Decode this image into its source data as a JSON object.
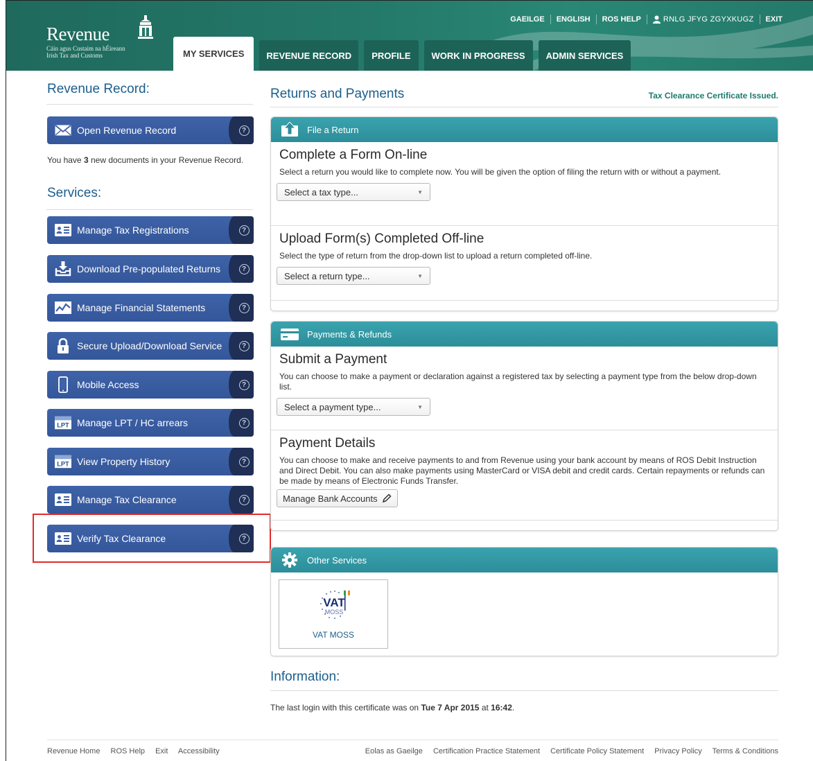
{
  "header": {
    "logo_word": "Revenue",
    "logo_sub1": "Cáin agus Custaim na hÉireann",
    "logo_sub2": "Irish Tax and Customs",
    "links": {
      "gaeilge": "GAEILGE",
      "english": "ENGLISH",
      "ros_help": "ROS HELP",
      "user": "RNLG JFYG ZGYXKUGZ",
      "exit": "EXIT"
    },
    "tabs": [
      "MY SERVICES",
      "REVENUE RECORD",
      "PROFILE",
      "WORK IN PROGRESS",
      "ADMIN SERVICES"
    ],
    "active_tab": "MY SERVICES",
    "brand_color": "#24796a"
  },
  "left": {
    "revenue_record_heading": "Revenue Record:",
    "open_record_label": "Open Revenue Record",
    "newdocs_prefix": "You have ",
    "newdocs_count": "3",
    "newdocs_suffix": " new documents in your Revenue Record.",
    "services_heading": "Services:",
    "services": [
      {
        "label": "Manage Tax Registrations",
        "icon": "id-card-icon"
      },
      {
        "label": "Download Pre-populated Returns",
        "icon": "download-tray-icon"
      },
      {
        "label": "Manage Financial Statements",
        "icon": "line-chart-icon"
      },
      {
        "label": "Secure Upload/Download Service",
        "icon": "padlock-icon"
      },
      {
        "label": "Mobile Access",
        "icon": "mobile-phone-icon"
      },
      {
        "label": "Manage LPT / HC arrears",
        "icon": "lpt-icon"
      },
      {
        "label": "View Property History",
        "icon": "lpt-icon"
      },
      {
        "label": "Manage Tax Clearance",
        "icon": "id-card-icon"
      },
      {
        "label": "Verify Tax Clearance",
        "icon": "id-card-icon"
      }
    ],
    "button_color": "#3a5ea3",
    "highlight_color": "#e02a2a"
  },
  "right": {
    "returns_heading": "Returns and Payments",
    "tcc_notice": "Tax Clearance Certificate Issued.",
    "file_return": {
      "title": "File a Return",
      "complete_heading": "Complete a Form On-line",
      "complete_text": "Select a return you would like to complete now. You will be given the option of filing the return with or without a payment.",
      "complete_select": "Select a tax type...",
      "upload_heading": "Upload Form(s) Completed Off-line",
      "upload_text": "Select the type of return from the drop-down list to upload a return completed off-line.",
      "upload_select": "Select a return type..."
    },
    "payments": {
      "title": "Payments & Refunds",
      "submit_heading": "Submit a Payment",
      "submit_text": "You can choose to make a payment or declaration against a registered tax by selecting a payment type from the below drop-down list.",
      "submit_select": "Select a payment type...",
      "details_heading": "Payment Details",
      "details_text": "You can choose to make and receive payments to and from Revenue using your bank account by means of ROS Debit Instruction and Direct Debit. You can also make payments using MasterCard or VISA debit and credit cards. Certain repayments or refunds can be made by means of Electronic Funds Transfer.",
      "manage_bank_label": "Manage Bank Accounts"
    },
    "other": {
      "title": "Other Services",
      "tile_logo_top": "VAT",
      "tile_logo_mid": "MOSS",
      "tile_label": "VAT MOSS"
    },
    "info_heading": "Information:",
    "info_prefix": "The last login with this certificate was on ",
    "info_date": "Tue 7 Apr 2015",
    "info_mid": " at ",
    "info_time": "16:42",
    "info_suffix": "."
  },
  "footer": {
    "left": [
      "Revenue Home",
      "ROS Help",
      "Exit",
      "Accessibility"
    ],
    "right": [
      "Eolas as Gaeilge",
      "Certification Practice Statement",
      "Certificate Policy Statement",
      "Privacy Policy",
      "Terms & Conditions"
    ]
  }
}
